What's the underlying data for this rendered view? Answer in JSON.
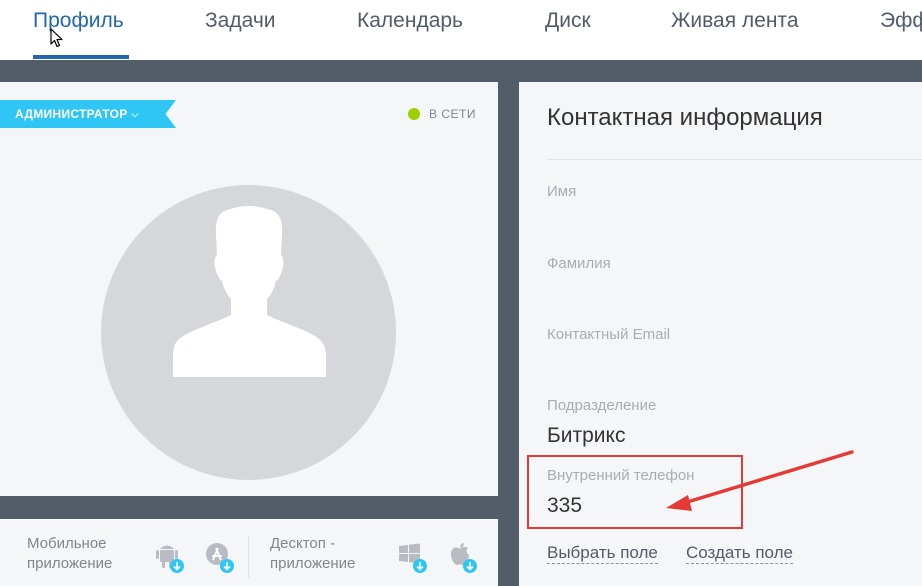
{
  "topnav": {
    "tabs": [
      {
        "label": "Профиль"
      },
      {
        "label": "Задачи"
      },
      {
        "label": "Календарь"
      },
      {
        "label": "Диск"
      },
      {
        "label": "Живая лента"
      },
      {
        "label": "Эфф"
      }
    ],
    "active_tab": "Профиль"
  },
  "profile": {
    "role_badge": "АДМИНИСТРАТОР",
    "status": "В СЕТИ",
    "status_color": "#9dcf00",
    "avatar_icon": "user-silhouette-icon"
  },
  "apps": {
    "mobile_label": "Мобильное приложение",
    "desktop_label": "Десктоп - приложение",
    "icons": [
      "android-download-icon",
      "appstore-download-icon",
      "windows-download-icon",
      "apple-download-icon"
    ]
  },
  "contact": {
    "title": "Контактная информация",
    "fields": [
      {
        "label": "Имя",
        "value": ""
      },
      {
        "label": "Фамилия",
        "value": ""
      },
      {
        "label": "Контактный Email",
        "value": ""
      },
      {
        "label": "Подразделение",
        "value": "Битрикс"
      },
      {
        "label": "Внутренний телефон",
        "value": "335"
      }
    ],
    "links": {
      "select_field": "Выбрать поле",
      "create_field": "Создать поле"
    }
  },
  "colors": {
    "accent": "#2067b0",
    "badge": "#2fc6f6",
    "annotation": "#e53935",
    "background": "#535c69"
  }
}
